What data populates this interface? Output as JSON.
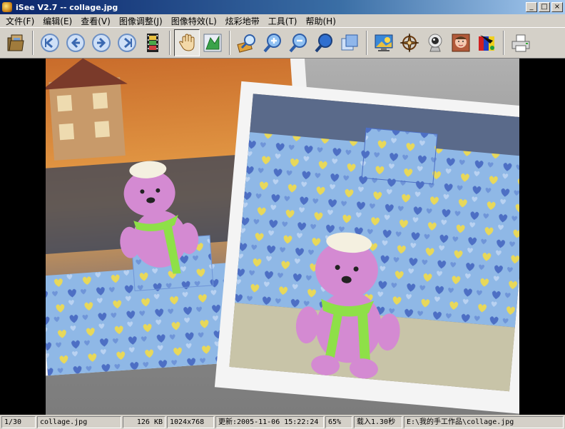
{
  "window": {
    "title": "iSee V2.7 -- collage.jpg",
    "buttons": {
      "minimize": "_",
      "maximize": "□",
      "close": "×"
    }
  },
  "menu": {
    "items": [
      "文件(F)",
      "编辑(E)",
      "查看(V)",
      "图像调整(J)",
      "图像特效(L)",
      "炫彩地带",
      "工具(T)",
      "帮助(H)"
    ]
  },
  "toolbar": {
    "groups": [
      [
        "open-folder-icon"
      ],
      [
        "first-image-icon",
        "previous-image-icon",
        "next-image-icon",
        "last-image-icon",
        "filmstrip-icon"
      ],
      [
        "hand-pan-icon",
        "fit-window-icon"
      ],
      [
        "magnifier-edit-icon",
        "zoom-in-icon",
        "zoom-out-icon",
        "zoom-actual-icon",
        "fullscreen-icon"
      ],
      [
        "wallpaper-icon",
        "compass-rose-icon",
        "webcam-icon",
        "face-photo-icon",
        "color-effects-icon"
      ],
      [
        "printer-icon"
      ]
    ],
    "pressed": "hand-pan-icon"
  },
  "photo": {
    "file": "collage.jpg",
    "subject": "pink crocheted teddy bear with green scarf"
  },
  "status": {
    "index": "1/30",
    "filename": "collage.jpg",
    "filesize": "126 KB",
    "dimensions": "1024x768",
    "modified": "更新:2005-11-06 15:22:24",
    "zoom": "65%",
    "load_time": "载入1.30秒",
    "path": "E:\\我的手工作品\\collage.jpg"
  }
}
